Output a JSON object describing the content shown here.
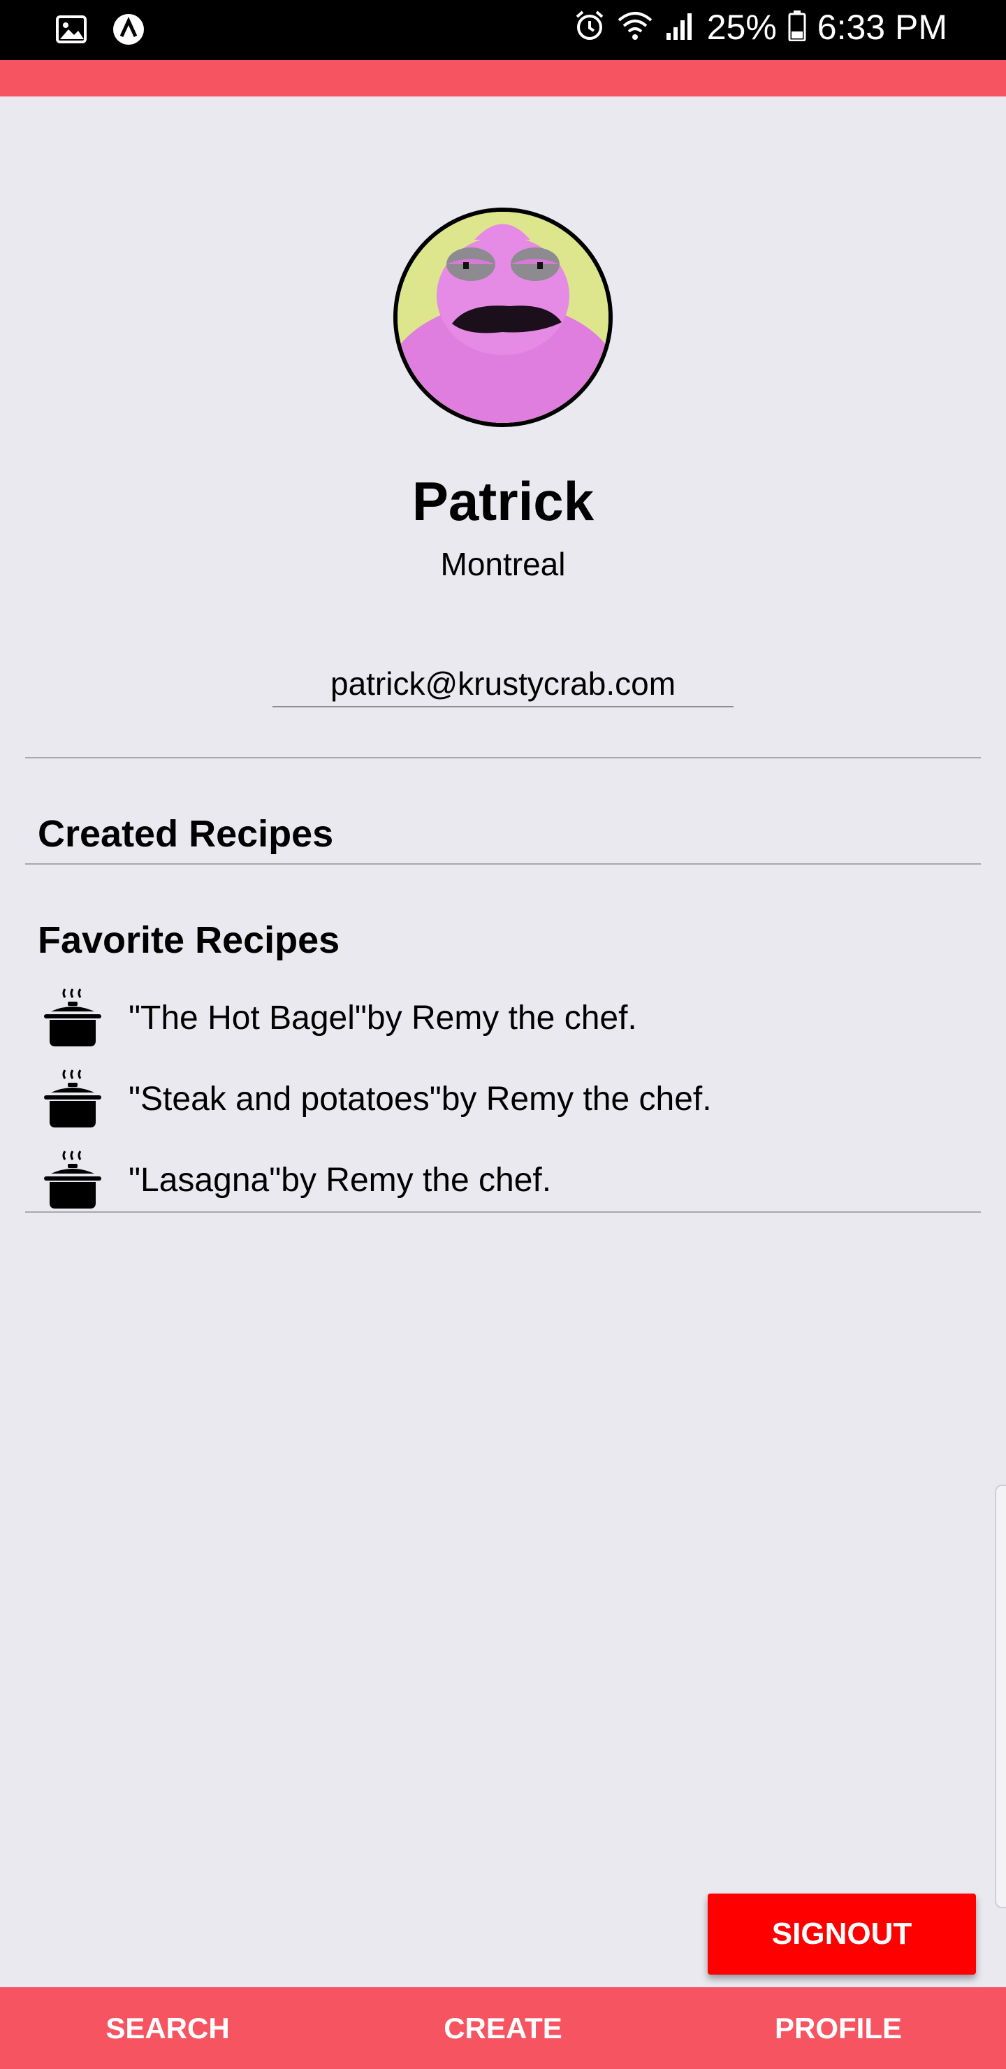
{
  "status_bar": {
    "battery": "25%",
    "time": "6:33 PM"
  },
  "profile": {
    "name": "Patrick",
    "city": "Montreal",
    "email": "patrick@krustycrab.com"
  },
  "sections": {
    "created_title": "Created Recipes",
    "favorite_title": "Favorite Recipes"
  },
  "favorites": [
    {
      "text": "\"The Hot Bagel\"by Remy the chef."
    },
    {
      "text": "\"Steak and potatoes\"by Remy the chef."
    },
    {
      "text": "\"Lasagna\"by Remy the chef."
    }
  ],
  "signout_label": "SIGNOUT",
  "bottom_nav": [
    {
      "label": "SEARCH"
    },
    {
      "label": "CREATE"
    },
    {
      "label": "PROFILE"
    }
  ],
  "colors": {
    "accent": "#f75462",
    "signout": "#ff0000",
    "background": "#eae9ef"
  }
}
